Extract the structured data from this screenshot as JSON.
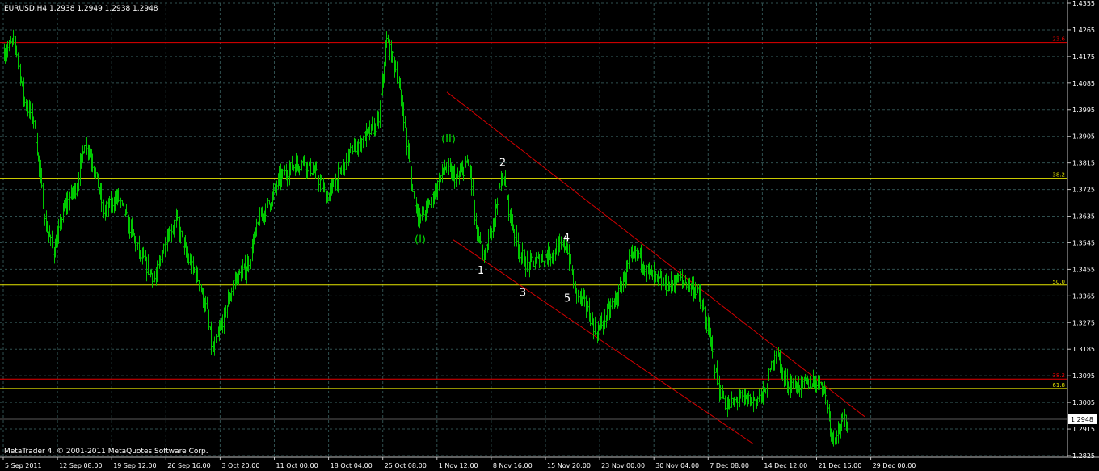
{
  "window": {
    "symbol_header": "EURUSD,H4  1.2938 1.2949 1.2938 1.2948",
    "copyright": "MetaTrader 4, © 2001-2011 MetaQuotes Software Corp."
  },
  "colors": {
    "background": "#000000",
    "grid": "#2f4f4f",
    "candles": "#00c800",
    "fib_red": "#e60000",
    "fib_yellow": "#e6e600",
    "channel": "#d40000",
    "price_box": "#ffffff"
  },
  "chart_data": {
    "type": "line",
    "symbol": "EURUSD",
    "timeframe": "H4",
    "ohlc_header": {
      "open": 1.2938,
      "high": 1.2949,
      "low": 1.2938,
      "close": 1.2948
    },
    "current_price": "1.2948",
    "ylim": [
      1.2825,
      1.4355
    ],
    "y_ticks": [
      "1.4355",
      "1.4265",
      "1.4175",
      "1.4085",
      "1.3995",
      "1.3905",
      "1.3815",
      "1.3725",
      "1.3635",
      "1.3545",
      "1.3455",
      "1.3365",
      "1.3275",
      "1.3185",
      "1.3095",
      "1.3005",
      "1.2915",
      "1.2825"
    ],
    "x_ticks": [
      "5 Sep 2011",
      "12 Sep 08:00",
      "19 Sep 12:00",
      "26 Sep 16:00",
      "3 Oct 20:00",
      "11 Oct 00:00",
      "18 Oct 04:00",
      "25 Oct 08:00",
      "1 Nov 12:00",
      "8 Nov 16:00",
      "15 Nov 20:00",
      "23 Nov 00:00",
      "30 Nov 04:00",
      "7 Dec 08:00",
      "14 Dec 12:00",
      "21 Dec 16:00",
      "29 Dec 00:00"
    ],
    "grid": true,
    "fib_levels": [
      {
        "label": "23.6",
        "price": 1.4222,
        "color": "red"
      },
      {
        "label": "38.2",
        "price": 1.3763,
        "color": "yellow"
      },
      {
        "label": "50.0",
        "price": 1.3402,
        "color": "yellow"
      },
      {
        "label": "38.2",
        "price": 1.3084,
        "color": "red"
      },
      {
        "label": "61.8",
        "price": 1.3052,
        "color": "yellow"
      }
    ],
    "wave_labels": [
      {
        "text": "(I)",
        "color": "green",
        "bar": 520,
        "price": 1.3545
      },
      {
        "text": "(II)",
        "color": "green",
        "bar": 555,
        "price": 1.3885
      },
      {
        "text": "1",
        "color": "white",
        "bar": 595,
        "price": 1.344
      },
      {
        "text": "2",
        "color": "white",
        "bar": 622,
        "price": 1.3805
      },
      {
        "text": "3",
        "color": "white",
        "bar": 647,
        "price": 1.3365
      },
      {
        "text": "4",
        "color": "white",
        "bar": 701,
        "price": 1.355
      },
      {
        "text": "5",
        "color": "white",
        "bar": 702,
        "price": 1.3345
      }
    ],
    "channel_lines": [
      {
        "from": {
          "bar": 553,
          "price": 1.4055
        },
        "to": {
          "bar": 1070,
          "price": 1.2957
        }
      },
      {
        "from": {
          "bar": 561,
          "price": 1.3555
        },
        "to": {
          "bar": 932,
          "price": 1.2865
        }
      }
    ],
    "price_path": [
      [
        5,
        1.419
      ],
      [
        18,
        1.423
      ],
      [
        30,
        1.402
      ],
      [
        42,
        1.396
      ],
      [
        55,
        1.362
      ],
      [
        66,
        1.351
      ],
      [
        80,
        1.367
      ],
      [
        95,
        1.374
      ],
      [
        105,
        1.39
      ],
      [
        118,
        1.378
      ],
      [
        128,
        1.365
      ],
      [
        145,
        1.37
      ],
      [
        160,
        1.36
      ],
      [
        175,
        1.349
      ],
      [
        192,
        1.342
      ],
      [
        205,
        1.356
      ],
      [
        218,
        1.362
      ],
      [
        232,
        1.349
      ],
      [
        245,
        1.342
      ],
      [
        255,
        1.332
      ],
      [
        263,
        1.317
      ],
      [
        275,
        1.328
      ],
      [
        290,
        1.342
      ],
      [
        305,
        1.346
      ],
      [
        320,
        1.362
      ],
      [
        335,
        1.369
      ],
      [
        345,
        1.376
      ],
      [
        360,
        1.38
      ],
      [
        375,
        1.382
      ],
      [
        390,
        1.378
      ],
      [
        405,
        1.37
      ],
      [
        420,
        1.378
      ],
      [
        435,
        1.386
      ],
      [
        450,
        1.39
      ],
      [
        468,
        1.395
      ],
      [
        478,
        1.423
      ],
      [
        490,
        1.413
      ],
      [
        500,
        1.396
      ],
      [
        510,
        1.372
      ],
      [
        520,
        1.362
      ],
      [
        535,
        1.37
      ],
      [
        550,
        1.38
      ],
      [
        565,
        1.376
      ],
      [
        580,
        1.382
      ],
      [
        590,
        1.356
      ],
      [
        600,
        1.35
      ],
      [
        612,
        1.365
      ],
      [
        622,
        1.378
      ],
      [
        632,
        1.362
      ],
      [
        642,
        1.352
      ],
      [
        652,
        1.347
      ],
      [
        662,
        1.348
      ],
      [
        675,
        1.35
      ],
      [
        688,
        1.352
      ],
      [
        700,
        1.354
      ],
      [
        712,
        1.338
      ],
      [
        725,
        1.333
      ],
      [
        738,
        1.324
      ],
      [
        750,
        1.33
      ],
      [
        765,
        1.337
      ],
      [
        778,
        1.348
      ],
      [
        790,
        1.351
      ],
      [
        800,
        1.345
      ],
      [
        812,
        1.342
      ],
      [
        825,
        1.34
      ],
      [
        838,
        1.342
      ],
      [
        850,
        1.341
      ],
      [
        862,
        1.338
      ],
      [
        872,
        1.33
      ],
      [
        880,
        1.319
      ],
      [
        888,
        1.306
      ],
      [
        900,
        1.299
      ],
      [
        915,
        1.302
      ],
      [
        930,
        1.301
      ],
      [
        945,
        1.303
      ],
      [
        960,
        1.319
      ],
      [
        970,
        1.308
      ],
      [
        985,
        1.306
      ],
      [
        1000,
        1.307
      ],
      [
        1015,
        1.308
      ],
      [
        1022,
        1.302
      ],
      [
        1030,
        1.288
      ],
      [
        1040,
        1.293
      ],
      [
        1050,
        1.2948
      ]
    ]
  }
}
